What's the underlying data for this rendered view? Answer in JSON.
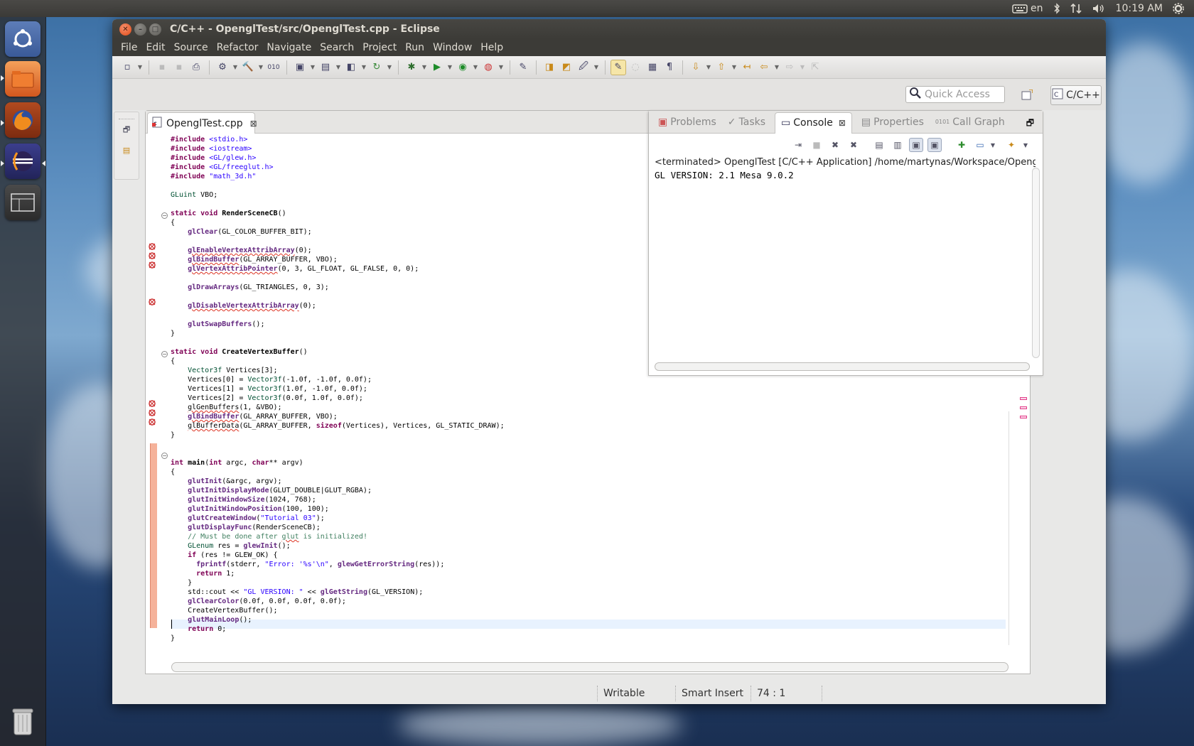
{
  "top_panel": {
    "keyboard_layout": "en",
    "clock": "10:19 AM"
  },
  "window": {
    "title": "C/C++ - OpenglTest/src/OpenglTest.cpp - Eclipse"
  },
  "menu": [
    "File",
    "Edit",
    "Source",
    "Refactor",
    "Navigate",
    "Search",
    "Project",
    "Run",
    "Window",
    "Help"
  ],
  "toolbar2": {
    "quick_access_placeholder": "Quick Access",
    "perspective_label": "C/C++"
  },
  "editor": {
    "tab_label": "OpenglTest.cpp",
    "cursor_position": "74 : 1"
  },
  "console": {
    "tabs": [
      "Problems",
      "Tasks",
      "Console",
      "Properties",
      "Call Graph"
    ],
    "active_tab": "Console",
    "header": "<terminated> OpenglTest [C/C++ Application] /home/martynas/Workspace/OpenglTest",
    "output": "GL VERSION: 2.1 Mesa 9.0.2"
  },
  "status_bar": {
    "writable": "Writable",
    "insert_mode": "Smart Insert",
    "position": "74 : 1"
  },
  "colors": {
    "title_bar": "#3c3b37",
    "accent_close": "#df4a16",
    "keyword": "#7f0055",
    "string": "#2a00ff",
    "comment": "#3f7f5f"
  }
}
